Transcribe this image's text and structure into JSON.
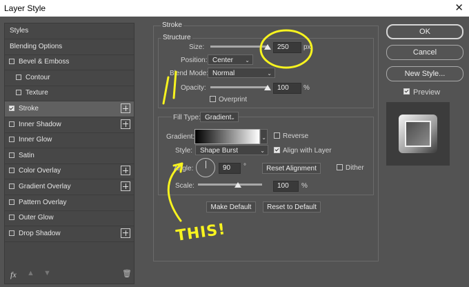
{
  "window": {
    "title": "Layer Style",
    "close_icon": "close-icon"
  },
  "left_panel": {
    "items": [
      {
        "label": "Styles",
        "checkbox": false,
        "plus": false,
        "indent": false
      },
      {
        "label": "Blending Options",
        "checkbox": false,
        "plus": false,
        "indent": false
      },
      {
        "label": "Bevel & Emboss",
        "checkbox": true,
        "checked": false,
        "plus": false,
        "indent": false
      },
      {
        "label": "Contour",
        "checkbox": true,
        "checked": false,
        "plus": false,
        "indent": true
      },
      {
        "label": "Texture",
        "checkbox": true,
        "checked": false,
        "plus": false,
        "indent": true
      },
      {
        "label": "Stroke",
        "checkbox": true,
        "checked": true,
        "plus": true,
        "indent": false,
        "selected": true
      },
      {
        "label": "Inner Shadow",
        "checkbox": true,
        "checked": false,
        "plus": true,
        "indent": false
      },
      {
        "label": "Inner Glow",
        "checkbox": true,
        "checked": false,
        "plus": false,
        "indent": false
      },
      {
        "label": "Satin",
        "checkbox": true,
        "checked": false,
        "plus": false,
        "indent": false
      },
      {
        "label": "Color Overlay",
        "checkbox": true,
        "checked": false,
        "plus": true,
        "indent": false
      },
      {
        "label": "Gradient Overlay",
        "checkbox": true,
        "checked": false,
        "plus": true,
        "indent": false
      },
      {
        "label": "Pattern Overlay",
        "checkbox": true,
        "checked": false,
        "plus": false,
        "indent": false
      },
      {
        "label": "Outer Glow",
        "checkbox": true,
        "checked": false,
        "plus": false,
        "indent": false
      },
      {
        "label": "Drop Shadow",
        "checkbox": true,
        "checked": false,
        "plus": true,
        "indent": false
      }
    ],
    "bottom": {
      "fx_label": "fx",
      "icons": [
        "arrow-up-icon",
        "arrow-down-icon",
        "trash-icon"
      ]
    }
  },
  "stroke": {
    "title": "Stroke",
    "structure": {
      "title": "Structure",
      "size_label": "Size:",
      "size_value": "250",
      "size_unit": "px",
      "position_label": "Position:",
      "position_value": "Center",
      "blend_mode_label": "Blend Mode:",
      "blend_mode_value": "Normal",
      "opacity_label": "Opacity:",
      "opacity_value": "100",
      "opacity_unit": "%",
      "overprint_label": "Overprint"
    },
    "fill_type_label": "Fill Type:",
    "fill_type_value": "Gradient",
    "gradient_label": "Gradient:",
    "reverse_label": "Reverse",
    "style_label": "Style:",
    "style_value": "Shape Burst",
    "align_label": "Align with Layer",
    "angle_label": "Angle:",
    "angle_value": "90",
    "angle_unit": "°",
    "reset_alignment_label": "Reset Alignment",
    "dither_label": "Dither",
    "scale_label": "Scale:",
    "scale_value": "100",
    "scale_unit": "%",
    "make_default_label": "Make Default",
    "reset_default_label": "Reset to Default"
  },
  "right_panel": {
    "ok_label": "OK",
    "cancel_label": "Cancel",
    "new_style_label": "New Style...",
    "preview_label": "Preview"
  },
  "annotation": {
    "text": "THIS!",
    "color": "#f7f31f"
  },
  "colors": {
    "dialog_bg": "#535353",
    "panel_bg": "#474747",
    "selected_bg": "#606060",
    "annotation": "#f7f31f"
  }
}
